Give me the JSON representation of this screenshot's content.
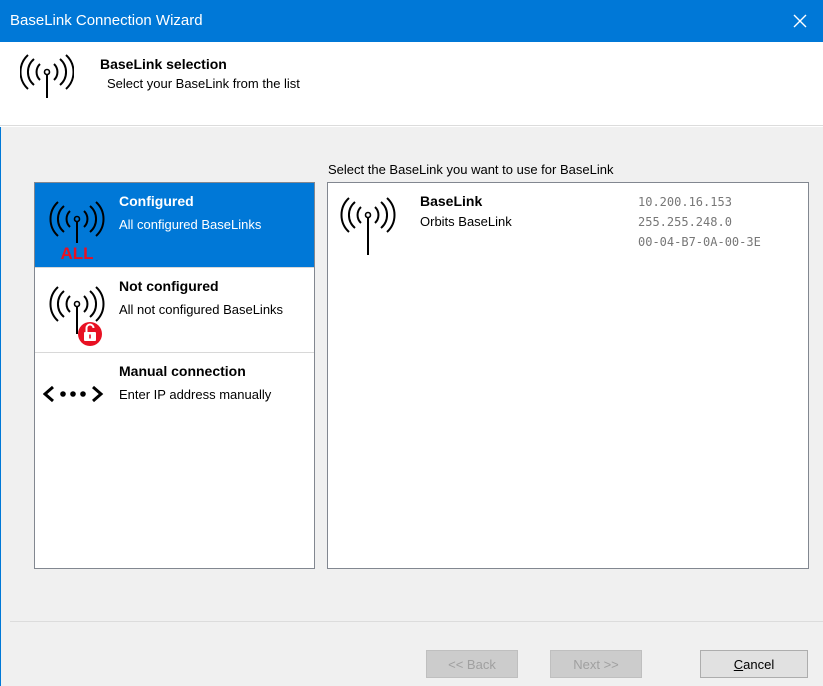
{
  "window": {
    "title": "BaseLink Connection Wizard",
    "close_glyph": "✕"
  },
  "header": {
    "title": "BaseLink selection",
    "subtitle": "Select your BaseLink from the list",
    "icon": "antenna-icon"
  },
  "categories": [
    {
      "title": "Configured",
      "subtitle": "All configured BaseLinks",
      "icon": "antenna-all-icon",
      "badge": "ALL",
      "selected": true
    },
    {
      "title": "Not configured",
      "subtitle": "All not configured BaseLinks",
      "icon": "antenna-unlocked-icon",
      "selected": false
    },
    {
      "title": "Manual connection",
      "subtitle": "Enter IP address manually",
      "icon": "manual-connection-icon",
      "selected": false
    }
  ],
  "baselinks": {
    "label": "Select the BaseLink you want to use for BaseLink",
    "items": [
      {
        "name": "BaseLink",
        "type": "Orbits BaseLink",
        "ip": "10.200.16.153",
        "mask": "255.255.248.0",
        "mac": "00-04-B7-0A-00-3E",
        "icon": "antenna-icon"
      }
    ]
  },
  "buttons": {
    "back": "<< Back",
    "next": "Next >>",
    "cancel_mnemonic": "C",
    "cancel_rest": "ancel"
  },
  "colors": {
    "accent": "#0078d7",
    "badge_red": "#e81123"
  }
}
